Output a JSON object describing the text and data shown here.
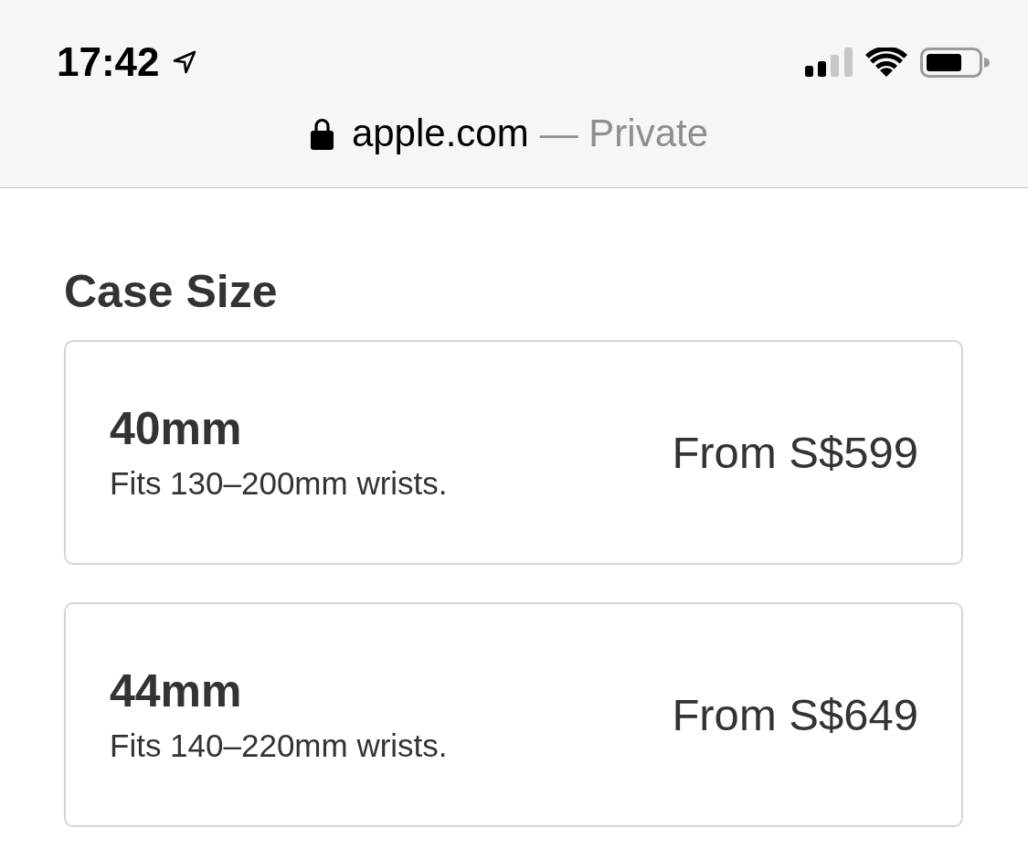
{
  "status_bar": {
    "time": "17:42"
  },
  "address_bar": {
    "domain": "apple.com",
    "mode": "— Private"
  },
  "case_size": {
    "title": "Case Size",
    "options": [
      {
        "size": "40mm",
        "fit": "Fits 130–200mm wrists.",
        "price": "From S$599",
        "selected": false
      },
      {
        "size": "44mm",
        "fit": "Fits 140–220mm wrists.",
        "price": "From S$649",
        "selected": false
      }
    ]
  }
}
